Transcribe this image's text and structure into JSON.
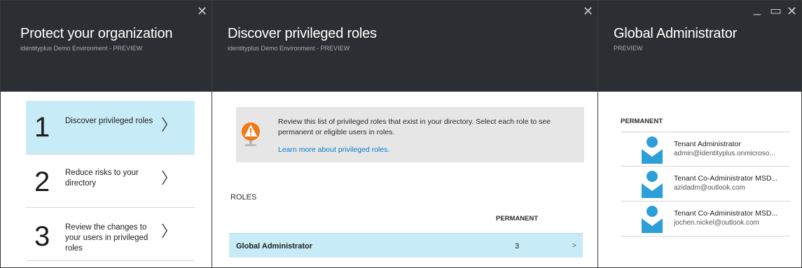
{
  "blade1": {
    "title": "Protect your organization",
    "subtitle": "identityplus Demo Environment - PREVIEW",
    "close_glyph": "✕",
    "steps": [
      {
        "num": "1",
        "text": "Discover privileged roles",
        "chevron": "〉"
      },
      {
        "num": "2",
        "text": "Reduce risks to your directory",
        "chevron": "〉"
      },
      {
        "num": "3",
        "text": "Review the changes to your users in privileged roles",
        "chevron": "〉"
      }
    ]
  },
  "blade2": {
    "title": "Discover privileged roles",
    "subtitle": "identityplus Demo Environment - PREVIEW",
    "close_glyph": "✕",
    "info_text": "Review this list of privileged roles that exist in your directory. Select each role to see permanent or eligible users in roles.",
    "info_link": "Learn more about privileged roles.",
    "roles_label": "ROLES",
    "column_header": "PERMANENT",
    "roles": [
      {
        "name": "Global Administrator",
        "permanent": "3",
        "chevron": ">"
      }
    ]
  },
  "blade3": {
    "title": "Global Administrator",
    "subtitle": "PREVIEW",
    "minimize_glyph": "_",
    "maximize_glyph": "▭",
    "close_glyph": "✕",
    "permanent_label": "PERMANENT",
    "users": [
      {
        "name": "Tenant Administrator",
        "email": "admin@identityplus.onmicroso..."
      },
      {
        "name": "Tenant Co-Administrator MSD...",
        "email": "azidadm@outlook.com"
      },
      {
        "name": "Tenant Co-Administrator MSD...",
        "email": "jochen.nickel@outlook.com"
      }
    ]
  },
  "colors": {
    "header_bg": "#2b2f33",
    "selected_bg": "#c7ecf8",
    "link": "#0a7cc7",
    "avatar": "#2c9fd9",
    "warning": "#f07a1a"
  },
  "icons": {
    "warning": "warning-icon",
    "avatar": "user-avatar-icon"
  }
}
